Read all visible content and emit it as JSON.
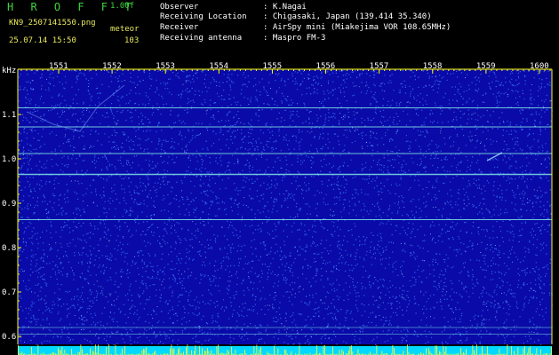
{
  "header": {
    "app_title": "H R O F F T",
    "version": "1.00f",
    "file_name": "KN9_2507141550.png",
    "mode": "meteor",
    "datetime": "25.07.14 15:50",
    "count": "103",
    "meta": [
      {
        "label": "Observer",
        "value": ": K.Nagai"
      },
      {
        "label": "Receiving Location",
        "value": ": Chigasaki, Japan (139.414 35.340)"
      },
      {
        "label": "Receiver",
        "value": ": AirSpy mini (Miakejima VOR 108.65MHz)"
      },
      {
        "label": "Receiving antenna",
        "value": ": Maspro FM-3"
      }
    ]
  },
  "spectrogram": {
    "y_axis_unit": "kHz",
    "y_ticks": [
      "1.1",
      "1.0",
      "0.9",
      "0.8",
      "0.7",
      "0.6"
    ],
    "x_ticks": [
      "1551",
      "1552",
      "1553",
      "1554",
      "1555",
      "1556",
      "1557",
      "1558",
      "1559",
      "1600"
    ],
    "colors": {
      "background": "#0a0aa8",
      "noise": "#3a7cff",
      "carrier": "#7fe6e6",
      "axis": "#ffff00",
      "bottom_bar": "#00d8ff",
      "bottom_spikes": "#ffff33"
    },
    "carrier_lines_khz": [
      1.115,
      1.072,
      1.012,
      0.965,
      0.863,
      0.62,
      0.605
    ]
  }
}
